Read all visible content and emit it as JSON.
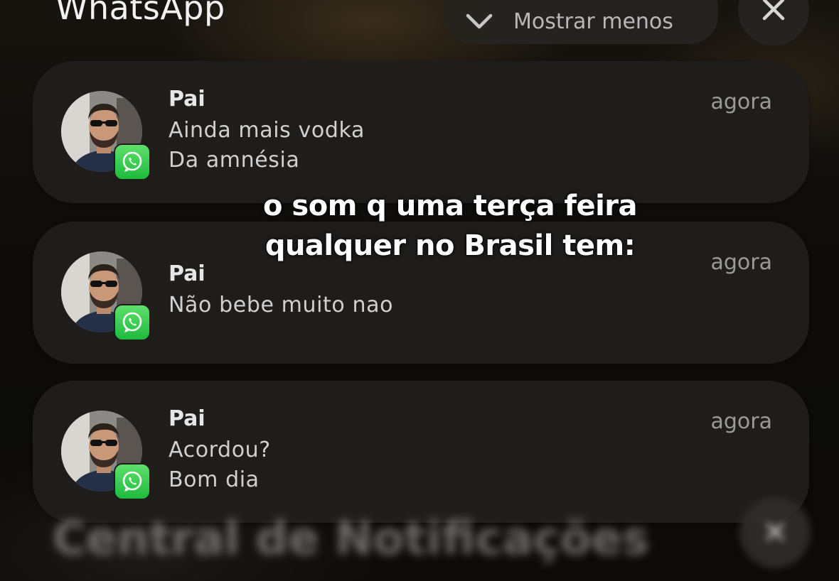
{
  "app_title": "WhatsApp",
  "controls": {
    "show_less_label": "Mostrar menos",
    "show_less_icon": "chevron-down-icon",
    "close_icon": "close-icon"
  },
  "notifications": [
    {
      "sender": "Pai",
      "lines": [
        "Ainda mais vodka",
        "Da amnésia"
      ],
      "time": "agora",
      "app_icon": "whatsapp-icon"
    },
    {
      "sender": "Pai",
      "lines": [
        "Não bebe muito nao"
      ],
      "time": "agora",
      "app_icon": "whatsapp-icon"
    },
    {
      "sender": "Pai",
      "lines": [
        "Acordou?",
        "Bom dia"
      ],
      "time": "agora",
      "app_icon": "whatsapp-icon"
    }
  ],
  "caption": {
    "line1": "o som q uma terça feira",
    "line2": "qualquer no Brasil tem:"
  },
  "notification_center": {
    "title": "Central de Notificações"
  },
  "colors": {
    "whatsapp_green": "#25D366",
    "card_bg": "#1e1d1c"
  }
}
